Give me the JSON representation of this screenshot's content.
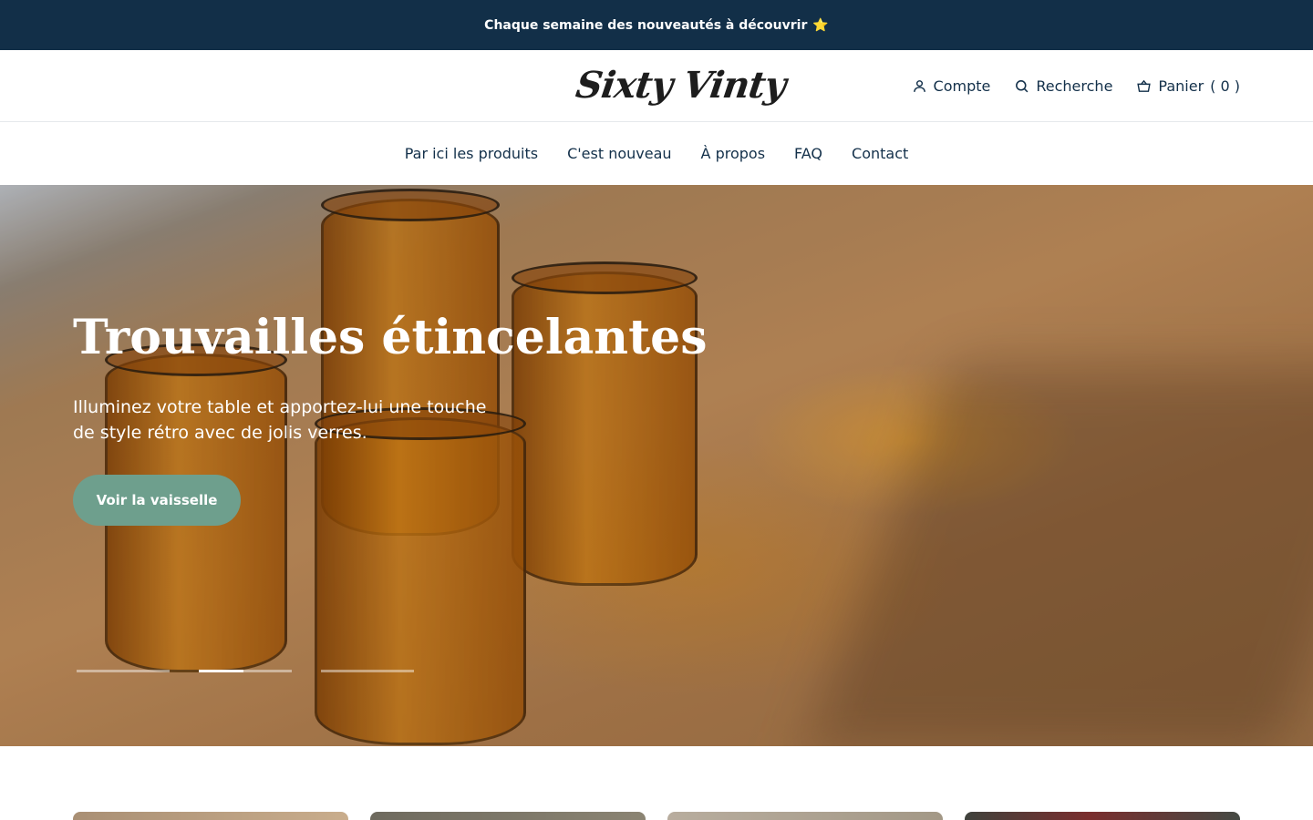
{
  "announcement": {
    "text": "Chaque semaine des nouveautés à découvrir",
    "emoji": "⭐"
  },
  "header": {
    "logo_text": "Sixty Vinty",
    "account_label": "Compte",
    "search_label": "Recherche",
    "cart_label": "Panier",
    "cart_count": "( 0 )"
  },
  "nav": {
    "items": [
      {
        "label": "Par ici les produits"
      },
      {
        "label": "C'est nouveau"
      },
      {
        "label": "À propos"
      },
      {
        "label": "FAQ"
      },
      {
        "label": "Contact"
      }
    ]
  },
  "hero": {
    "title": "Trouvailles étincelantes",
    "text": "Illuminez votre table et apportez-lui une touche de style rétro avec de jolis verres.",
    "button_label": "Voir la vaisselle",
    "slides_total": 3,
    "active_slide": 2,
    "active_slide_progress": 0.48
  },
  "colors": {
    "announcement_bg": "#122f48",
    "text": "#13304a",
    "button_bg": "#6e9f8d"
  },
  "icons": {
    "account": "user-icon",
    "search": "search-icon",
    "cart": "basket-icon"
  }
}
